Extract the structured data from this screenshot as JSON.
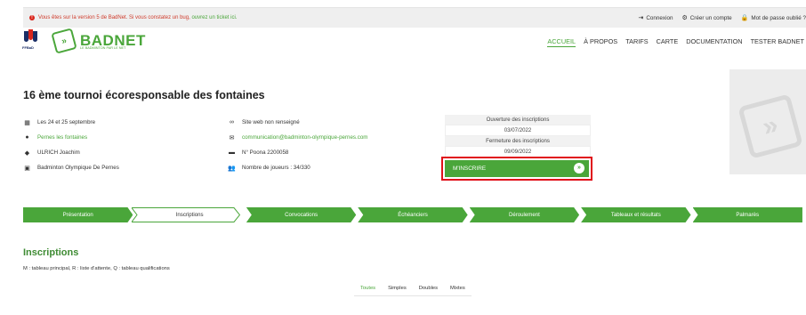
{
  "topbar": {
    "notice_text": "Vous êtes sur la version 5 de BadNet. Si vous constatez un bug,",
    "notice_link": "ouvrez un ticket ici.",
    "connexion": "Connexion",
    "create_account": "Créer un compte",
    "forgot_password": "Mot de passe oublié ?"
  },
  "brand": {
    "name": "BADNET",
    "tagline": "LE BADMINTON PAR LE NET",
    "federation": "FFBaD"
  },
  "nav": [
    "ACCUEIL",
    "À PROPOS",
    "TARIFS",
    "CARTE",
    "DOCUMENTATION",
    "TESTER BADNET"
  ],
  "tournament": {
    "title": "16 ème tournoi écoresponsable des fontaines",
    "dates": "Les 24 et 25 septembre",
    "location": "Pernes les fontaines",
    "organizer": "ULRICH Joachim",
    "club": "Badminton Olympique De Pernes",
    "website": "Site web non renseigné",
    "email": "communication@badminton-olympique-pernes.com",
    "poona": "N° Poona 2200058",
    "players": "Nombre de joueurs : 34/330"
  },
  "registration": {
    "open_label": "Ouverture des inscriptions",
    "open_date": "03/07/2022",
    "close_label": "Fermeture des inscriptions",
    "close_date": "09/09/2022",
    "button": "M'INSCRIRE"
  },
  "steps": [
    "Présentation",
    "Inscriptions",
    "Convocations",
    "Échéanciers",
    "Déroulement",
    "Tableaux et résultats",
    "Palmarès"
  ],
  "inscriptions": {
    "title": "Inscriptions",
    "legend": "M : tableau principal, R : liste d'attente, Q : tableau qualifications",
    "filters": [
      "Toutes",
      "Simples",
      "Doubles",
      "Mixtes"
    ]
  },
  "colors": {
    "accent": "#4aa63a",
    "highlight": "#e0111a"
  }
}
